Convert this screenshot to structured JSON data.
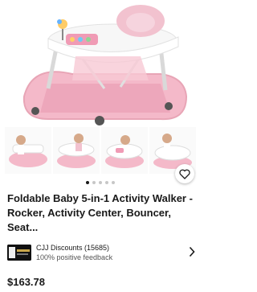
{
  "listing": {
    "title": "Foldable Baby 5-in-1 Activity Walker - Rocker, Activity Center, Bouncer, Seat...",
    "price": "$163.78"
  },
  "seller": {
    "name": "CJJ Discounts (15685)",
    "feedback": "100% positive feedback"
  },
  "gallery": {
    "dots_count": 5,
    "active_dot": 0
  },
  "icons": {
    "favorite": "heart-icon",
    "seller_chevron": "chevron-right-icon"
  },
  "colors": {
    "product_pink": "#f3b8c8",
    "frame_white": "#f5f5f5",
    "text": "#191919"
  }
}
